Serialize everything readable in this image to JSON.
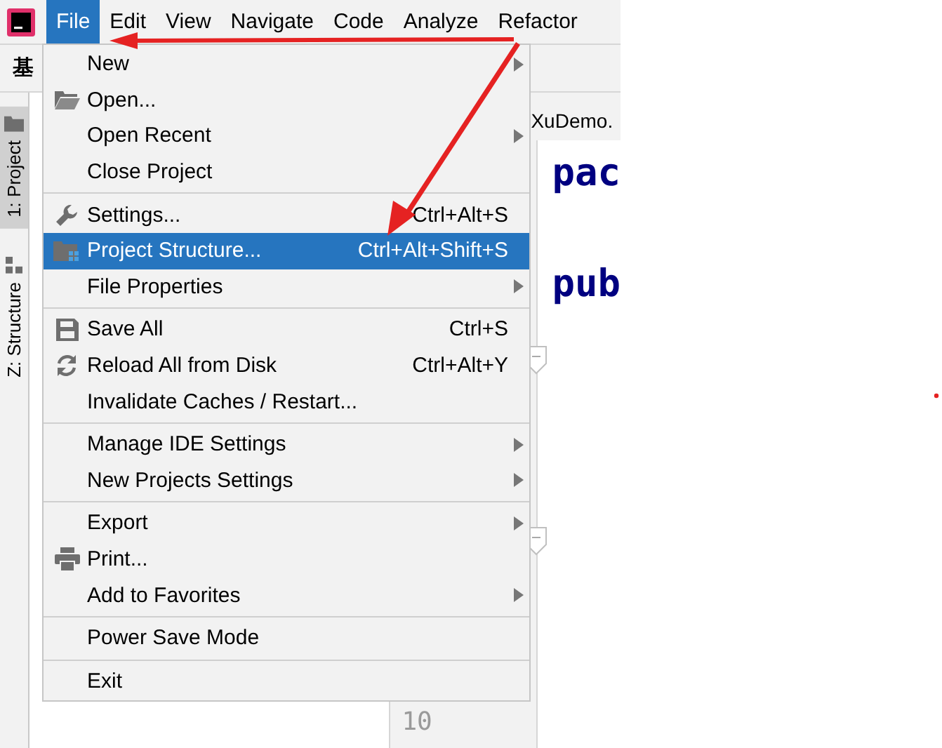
{
  "menubar": {
    "items": [
      {
        "label": "File",
        "selected": true
      },
      {
        "label": "Edit",
        "selected": false
      },
      {
        "label": "View",
        "selected": false
      },
      {
        "label": "Navigate",
        "selected": false
      },
      {
        "label": "Code",
        "selected": false
      },
      {
        "label": "Analyze",
        "selected": false
      },
      {
        "label": "Refactor",
        "selected": false
      }
    ]
  },
  "toolbar": {
    "breadcrumb": "基"
  },
  "tool_window_tabs": [
    {
      "label": "1: Project",
      "selected": true
    },
    {
      "label": "Z: Structure",
      "selected": false
    }
  ],
  "editor": {
    "tab": "XuDemo.",
    "lines": [
      "pac",
      "pub"
    ],
    "line_number": "10"
  },
  "file_menu": {
    "groups": [
      [
        {
          "label": "New",
          "submenu": true,
          "selected": false
        },
        {
          "label": "Open...",
          "submenu": false,
          "selected": false
        },
        {
          "label": "Open Recent",
          "submenu": true,
          "selected": false
        },
        {
          "label": "Close Project",
          "submenu": false,
          "selected": false
        }
      ],
      [
        {
          "label": "Settings...",
          "shortcut": "Ctrl+Alt+S",
          "submenu": false,
          "selected": false
        },
        {
          "label": "Project Structure...",
          "shortcut": "Ctrl+Alt+Shift+S",
          "submenu": false,
          "selected": true
        },
        {
          "label": "File Properties",
          "submenu": true,
          "selected": false
        }
      ],
      [
        {
          "label": "Save All",
          "shortcut": "Ctrl+S",
          "submenu": false,
          "selected": false
        },
        {
          "label": "Reload All from Disk",
          "shortcut": "Ctrl+Alt+Y",
          "submenu": false,
          "selected": false
        },
        {
          "label": "Invalidate Caches / Restart...",
          "submenu": false,
          "selected": false
        }
      ],
      [
        {
          "label": "Manage IDE Settings",
          "submenu": true,
          "selected": false
        },
        {
          "label": "New Projects Settings",
          "submenu": true,
          "selected": false
        }
      ],
      [
        {
          "label": "Export",
          "submenu": true,
          "selected": false
        },
        {
          "label": "Print...",
          "submenu": false,
          "selected": false
        },
        {
          "label": "Add to Favorites",
          "submenu": true,
          "selected": false
        }
      ],
      [
        {
          "label": "Power Save Mode",
          "submenu": false,
          "selected": false
        }
      ],
      [
        {
          "label": "Exit",
          "submenu": false,
          "selected": false
        }
      ]
    ]
  }
}
